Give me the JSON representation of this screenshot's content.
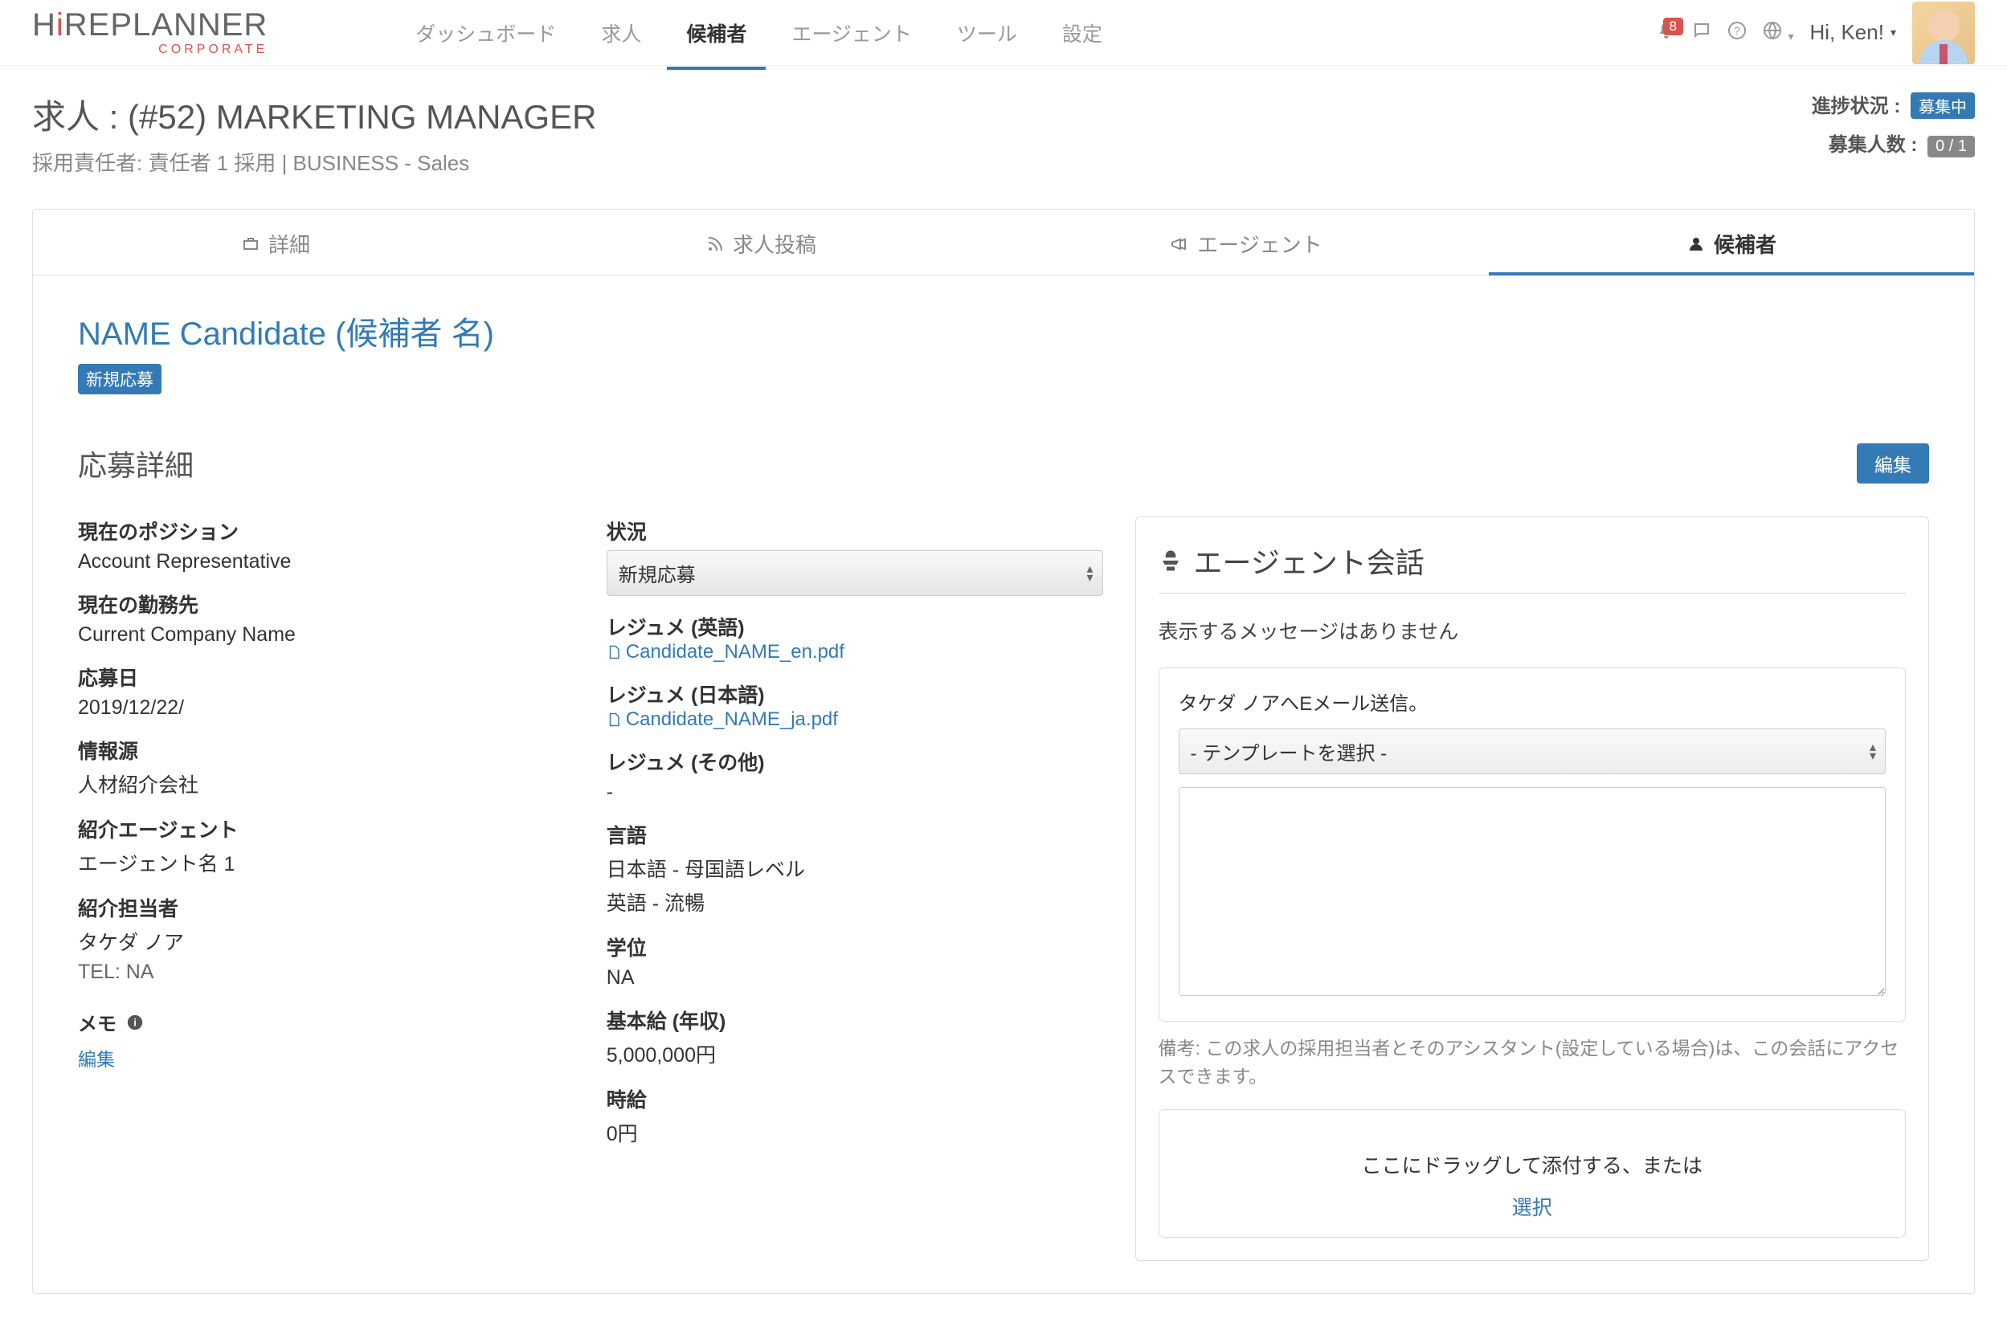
{
  "nav": {
    "dashboard": "ダッシュボード",
    "jobs": "求人",
    "candidates": "候補者",
    "agents": "エージェント",
    "tools": "ツール",
    "settings": "設定"
  },
  "notifications_count": "8",
  "greeting": "Hi, Ken!",
  "logo": {
    "brand": "HiREPLANNER",
    "sub": "CORPORATE"
  },
  "page": {
    "title": "求人 : (#52) MARKETING MANAGER",
    "subtitle": "採用責任者: 責任者 1 採用 | BUSINESS - Sales"
  },
  "status": {
    "progress_label": "進捗状況 :",
    "progress_value": "募集中",
    "headcount_label": "募集人数 :",
    "headcount_value": "0 / 1"
  },
  "sub_tabs": {
    "details": "詳細",
    "posting": "求人投稿",
    "agents": "エージェント",
    "candidates": "候補者"
  },
  "candidate": {
    "name": "NAME Candidate (候補者 名)",
    "status_badge": "新規応募"
  },
  "section": {
    "app_details_title": "応募詳細",
    "edit_btn": "編集"
  },
  "fields_left": {
    "current_position_label": "現在のポジション",
    "current_position_value": "Account Representative",
    "current_company_label": "現在の勤務先",
    "current_company_value": "Current Company Name",
    "date_applied_label": "応募日",
    "date_applied_value": "2019/12/22/",
    "source_label": "情報源",
    "source_value": "人材紹介会社",
    "agency_label": "紹介エージェント",
    "agency_value": "エージェント名 1",
    "person_label": "紹介担当者",
    "person_value": "タケダ ノア",
    "person_tel": "TEL: NA"
  },
  "fields_right": {
    "status_label": "状況",
    "status_value": "新規応募",
    "resume_en_label": "レジュメ (英語)",
    "resume_en_file": "Candidate_NAME_en.pdf",
    "resume_ja_label": "レジュメ (日本語)",
    "resume_ja_file": "Candidate_NAME_ja.pdf",
    "resume_other_label": "レジュメ (その他)",
    "resume_other_value": "-",
    "language_label": "言語",
    "language_value_1": "日本語 - 母国語レベル",
    "language_value_2": "英語 - 流暢",
    "degree_label": "学位",
    "degree_value": "NA",
    "base_label": "基本給 (年収)",
    "base_value": "5,000,000円",
    "hourly_label": "時給",
    "hourly_value": "0円"
  },
  "memo": {
    "label": "メモ",
    "edit": "編集"
  },
  "agent_panel": {
    "title": "エージェント会話",
    "no_messages": "表示するメッセージはありません",
    "compose_to": "タケダ ノアへEメール送信。",
    "template_placeholder": "- テンプレートを選択 -",
    "note": "備考: この求人の採用担当者とそのアシスタント(設定している場合)は、この会話にアクセスできます。",
    "dropzone_text": "ここにドラッグして添付する、または",
    "dropzone_select": "選択"
  }
}
